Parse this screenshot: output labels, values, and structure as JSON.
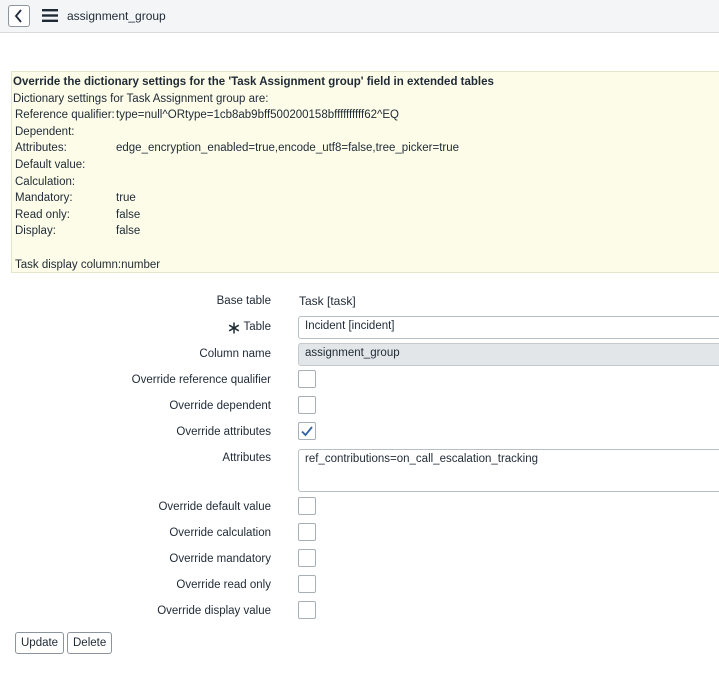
{
  "header": {
    "title": "assignment_group",
    "back_icon": "chevron-left-icon",
    "menu_icon": "hamburger-menu-icon"
  },
  "info": {
    "title": "Override the dictionary settings for the 'Task Assignment group' field in extended tables",
    "subtitle": "Dictionary settings for Task Assignment group are:",
    "reference_qualifier_label": "Reference qualifier:",
    "reference_qualifier_value": "type=null^ORtype=1cb8ab9bff500200158bffffffffff62^EQ",
    "dependent_label": "Dependent:",
    "dependent_value": "",
    "attributes_label": "Attributes:",
    "attributes_value": "edge_encryption_enabled=true,encode_utf8=false,tree_picker=true",
    "default_value_label": "Default value:",
    "default_value_value": "",
    "calculation_label": "Calculation:",
    "calculation_value": "",
    "mandatory_label": "Mandatory:",
    "mandatory_value": "true",
    "read_only_label": "Read only:",
    "read_only_value": "false",
    "display_label": "Display:",
    "display_value": "false",
    "display_column_label": "Task display column:",
    "display_column_value": "number"
  },
  "form": {
    "base_table_label": "Base table",
    "base_table_value": "Task [task]",
    "table_label": "Table",
    "table_value": "Incident [incident]",
    "column_name_label": "Column name",
    "column_name_value": "assignment_group",
    "override_reference_qualifier_label": "Override reference qualifier",
    "override_reference_qualifier_checked": false,
    "override_dependent_label": "Override dependent",
    "override_dependent_checked": false,
    "override_attributes_label": "Override attributes",
    "override_attributes_checked": true,
    "attributes_label": "Attributes",
    "attributes_value": "ref_contributions=on_call_escalation_tracking",
    "override_default_value_label": "Override default value",
    "override_default_value_checked": false,
    "override_calculation_label": "Override calculation",
    "override_calculation_checked": false,
    "override_mandatory_label": "Override mandatory",
    "override_mandatory_checked": false,
    "override_read_only_label": "Override read only",
    "override_read_only_checked": false,
    "override_display_value_label": "Override display value",
    "override_display_value_checked": false
  },
  "buttons": {
    "update_label": "Update",
    "delete_label": "Delete"
  },
  "colors": {
    "checkmark": "#2e64a8",
    "info_background": "#fcfce8",
    "header_background": "#f3f5f6"
  }
}
